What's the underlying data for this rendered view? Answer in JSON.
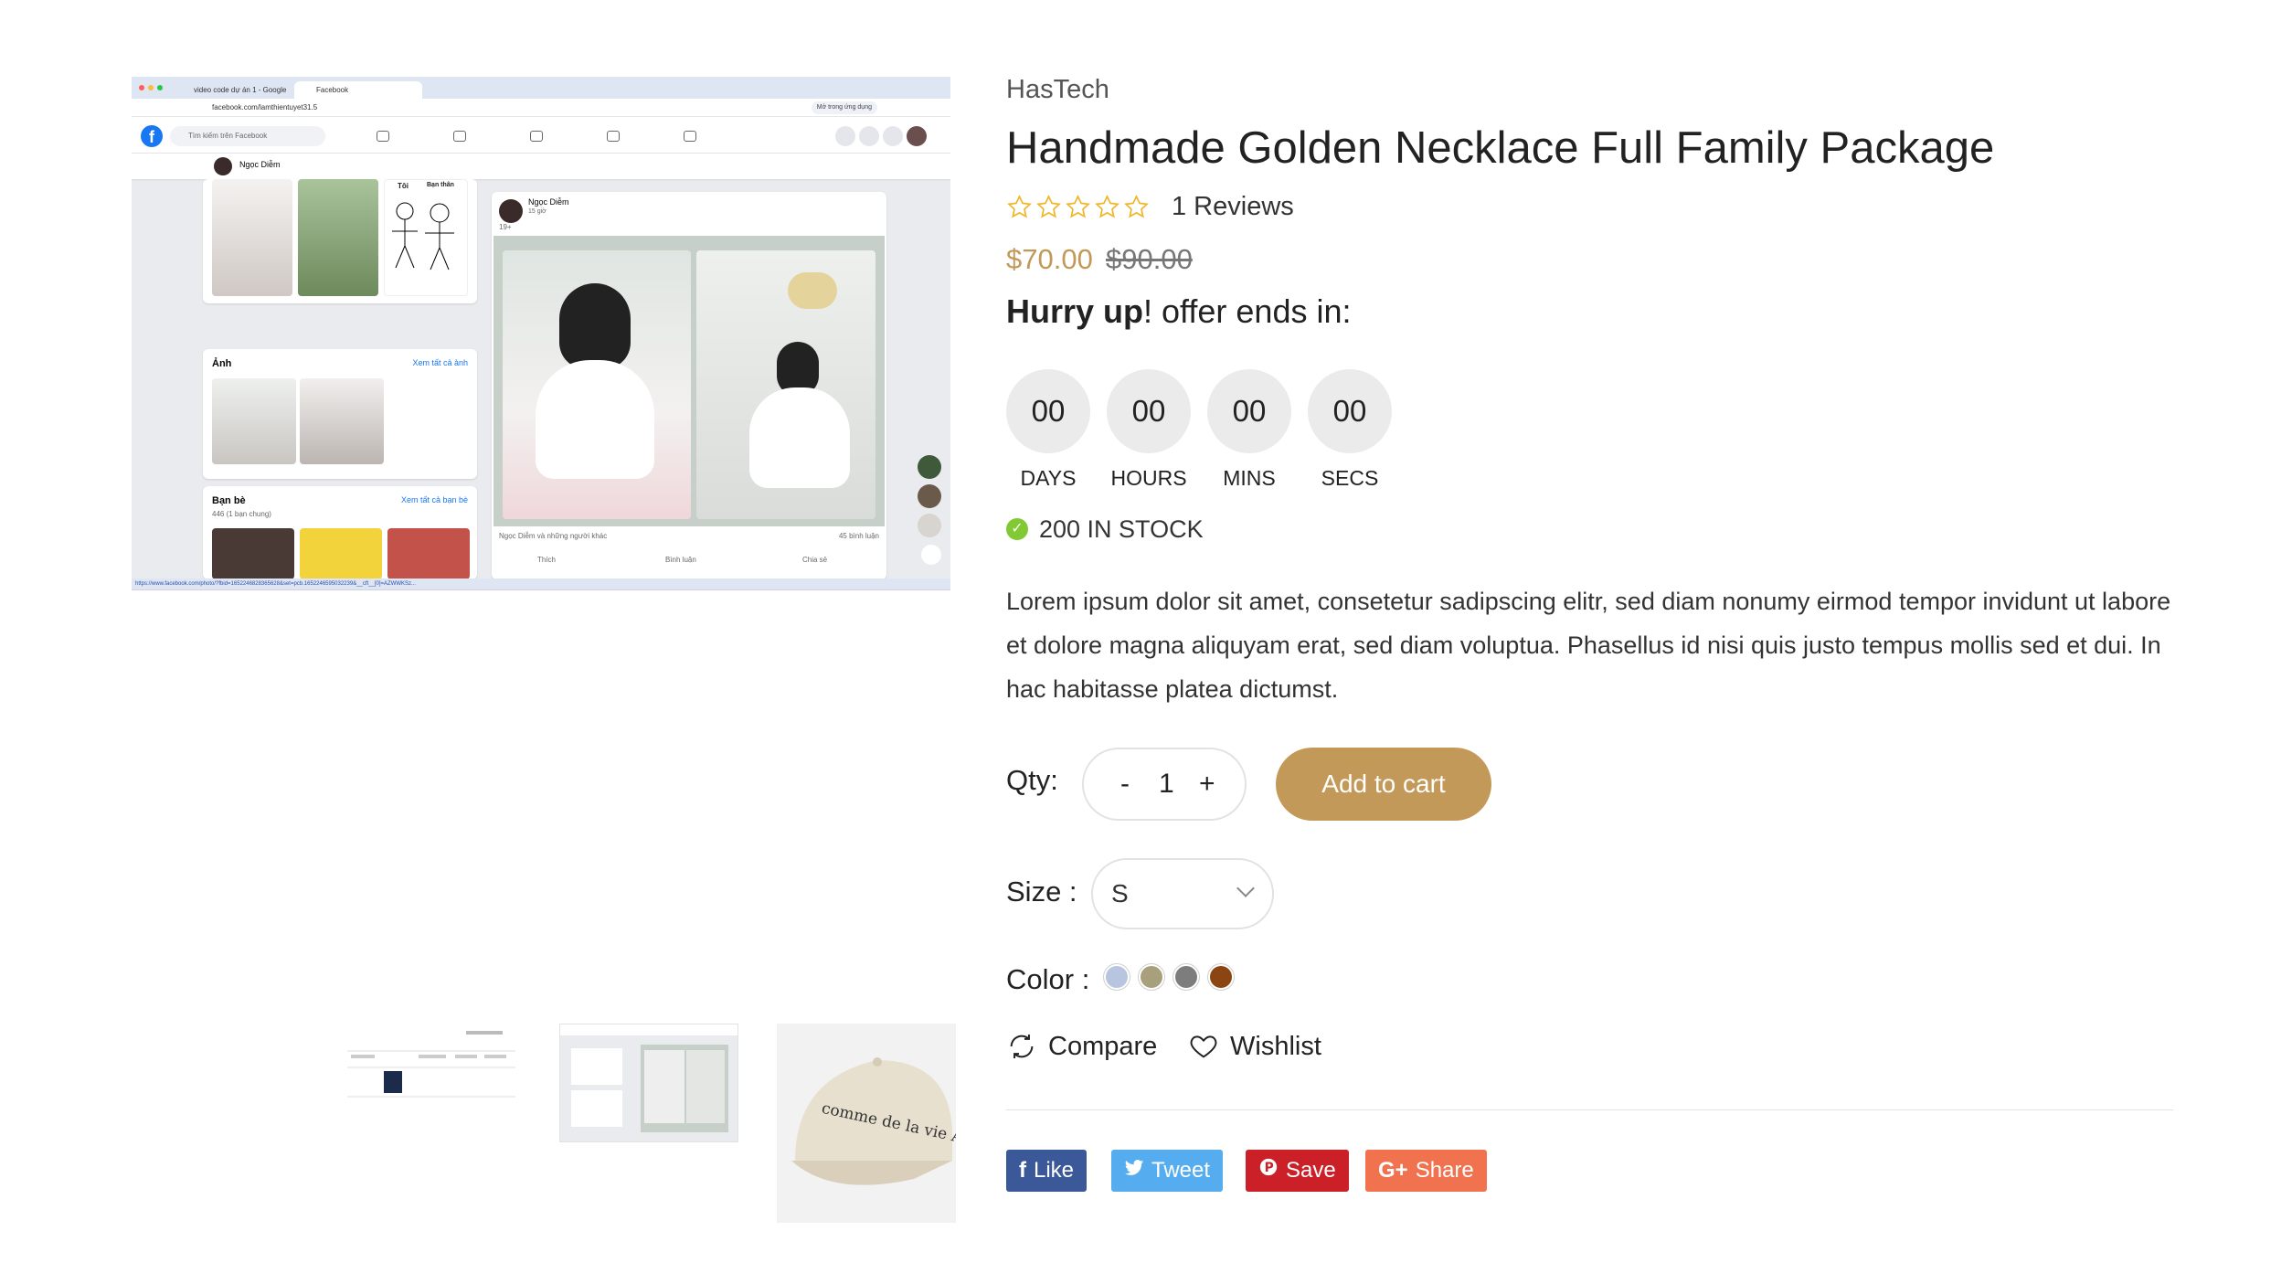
{
  "gallery": {
    "main": {
      "tabs": [
        "video code dự án 1 - Google",
        "Facebook"
      ],
      "url": "facebook.com/lamthientuyet31.5",
      "url_chip": "Mở trong ứng dụng",
      "search_placeholder": "Tìm kiếm trên Facebook",
      "profile_name": "Ngọc Diễm",
      "post_author": "Ngọc Diễm",
      "post_time": "15 giờ",
      "post_meta": "19+",
      "photos_title": "Ảnh",
      "photos_link": "Xem tất cả ảnh",
      "friends_title": "Bạn bè",
      "friends_link": "Xem tất cả bạn bè",
      "friends_count": "446 (1 bạn chung)",
      "reactions_text": "Ngọc Diễm và những người khác",
      "comments_count": "45 bình luận",
      "action_like": "Thích",
      "action_comment": "Bình luận",
      "action_share": "Chia sẻ",
      "sticker_label_1": "Tôi",
      "sticker_label_2": "Bạn thân",
      "status_url": "https://www.facebook.com/photo/?fbid=1652246828365628&set=pcb.1652246595032239&__cft__[0]=AZWWKSz..."
    },
    "thumb_cap_text": "comme de la vie ADLV"
  },
  "product": {
    "brand": "HasTech",
    "title": "Handmade Golden Necklace Full Family Package",
    "rating_stars": 0,
    "reviews": "1 Reviews",
    "price_new": "$70.00",
    "price_old": "$90.00",
    "hurry_bold": "Hurry up",
    "hurry_rest": "! offer ends in:",
    "countdown": [
      {
        "value": "00",
        "label": "DAYS"
      },
      {
        "value": "00",
        "label": "HOURS"
      },
      {
        "value": "00",
        "label": "MINS"
      },
      {
        "value": "00",
        "label": "SECS"
      }
    ],
    "stock": "200 IN STOCK",
    "description": "Lorem ipsum dolor sit amet, consetetur sadipscing elitr, sed diam nonumy eirmod tempor invidunt ut labore et dolore magna aliquyam erat, sed diam voluptua. Phasellus id nisi quis justo tempus mollis sed et dui. In hac habitasse platea dictumst.",
    "qty_label": "Qty:",
    "qty_minus": "-",
    "qty_value": "1",
    "qty_plus": "+",
    "add_to_cart": "Add to cart",
    "size_label": "Size :",
    "size_value": "S",
    "color_label": "Color :",
    "colors": [
      "#b8c5e0",
      "#a89f7c",
      "#7d7d7d",
      "#8b4513"
    ],
    "compare": "Compare",
    "wishlist": "Wishlist",
    "share": [
      {
        "label": "Like",
        "icon": "f",
        "color": "#3b5998"
      },
      {
        "label": "Tweet",
        "icon": "🐦",
        "color": "#55acee"
      },
      {
        "label": "Save",
        "icon": "P",
        "color": "#cb2027"
      },
      {
        "label": "Share",
        "icon": "G+",
        "color": "#f0724f"
      }
    ]
  },
  "theme": {
    "accent": "#c29958",
    "star": "#f0b528",
    "stock_check": "#81ca33"
  }
}
